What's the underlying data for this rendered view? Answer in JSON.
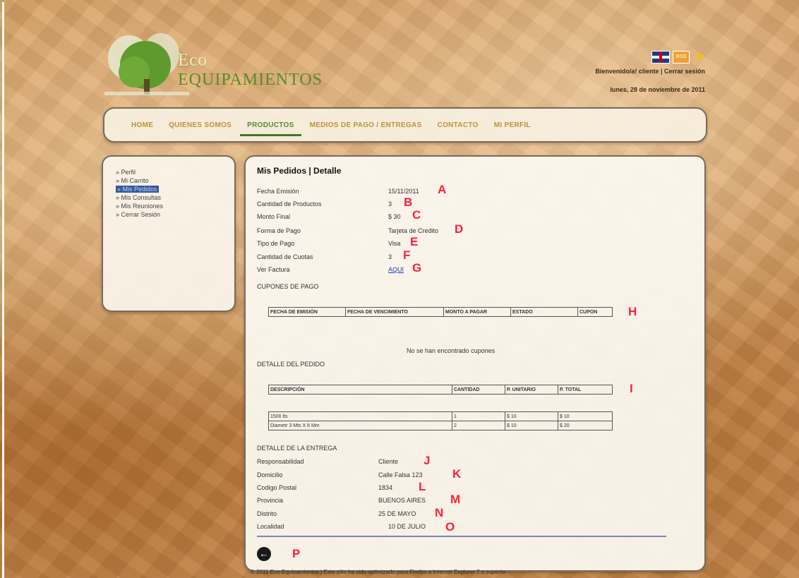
{
  "header": {
    "logo_line1": "Eco",
    "logo_line2": "EQUIPAMIENTOS",
    "welcome": "Bienvenido/a! cliente | Cerrar sesión",
    "date": "lunes, 28 de noviembre de 2011"
  },
  "nav": {
    "items": [
      "HOME",
      "QUIENES SOMOS",
      "PRODUCTOS",
      "MEDIOS DE PAGO / ENTREGAS",
      "CONTACTO",
      "MI PERFIL"
    ],
    "active": "PRODUCTOS"
  },
  "sidebar": {
    "items": [
      "» Perfil",
      "» Mi Carrito",
      "» Mis Pedidos",
      "» Mis Consultas",
      "» Mis Reuniones",
      "» Cerrar Sesión"
    ],
    "selected": "» Mis Pedidos"
  },
  "main": {
    "title": "Mis Pedidos | Detalle",
    "order": {
      "fecha_label": "Fecha Emisión",
      "fecha_value": "15/11/2011",
      "fecha_letter": "A",
      "cantidad_label": "Cantidad de Productos",
      "cantidad_value": "3",
      "cantidad_letter": "B",
      "monto_label": "Monto Final",
      "monto_value": "$ 30",
      "monto_letter": "C",
      "forma_label": "Forma de Pago",
      "forma_value": "Tarjeta de Credito",
      "forma_letter": "D",
      "tipo_label": "Tipo de Pago",
      "tipo_value": "Visa",
      "tipo_letter": "E",
      "cuotas_label": "Cantidad de Cuotas",
      "cuotas_value": "3",
      "cuotas_letter": "F",
      "factura_label": "Ver Factura",
      "factura_value": "AQUI",
      "factura_letter": "G"
    },
    "cupones": {
      "section": "CUPONES DE PAGO",
      "headers": [
        "FECHA DE EMISIÓN",
        "FECHA DE VENCIMIENTO",
        "MONTO A PAGAR",
        "ESTADO",
        "CUPON"
      ],
      "letter": "H",
      "empty": "No se han encontrado cupones"
    },
    "detalle": {
      "section": "DETALLE DEL PEDIDO",
      "headers": [
        "DESCRIPCIÓN",
        "CANTIDAD",
        "P. UNITARIO",
        "P. TOTAL"
      ],
      "letter": "I",
      "rows": [
        [
          "1500 lts",
          "1",
          "$ 10",
          "$ 10"
        ],
        [
          "Diametr 3 Mts X 6 Mm",
          "2",
          "$ 10",
          "$ 20"
        ]
      ]
    },
    "entrega": {
      "section": "DETALLE DE LA ENTREGA",
      "resp_label": "Responsabilidad",
      "resp_value": "Cliente",
      "resp_letter": "J",
      "dom_label": "Domicilio",
      "dom_value": "Calle Falsa 123",
      "dom_letter": "K",
      "cp_label": "Codigo Postal",
      "cp_value": "1834",
      "cp_letter": "L",
      "prov_label": "Provincia",
      "prov_value": "BUENOS AIRES",
      "prov_letter": "M",
      "dist_label": "Distrito",
      "dist_value": "25 DE MAYO",
      "dist_letter": "N",
      "loc_label": "Localidad",
      "loc_value": "10 DE JULIO",
      "loc_letter": "O"
    },
    "back_letter": "P"
  },
  "footer": "© 2011 Eco-Equipamientos | Este sitio ha sido optimizado para Firefox e Internet Explorer 7 o superior",
  "colors": {
    "accent_green": "#5b8a2a",
    "nav_gold": "#b9933a",
    "marker_red": "#ff1f3a"
  }
}
